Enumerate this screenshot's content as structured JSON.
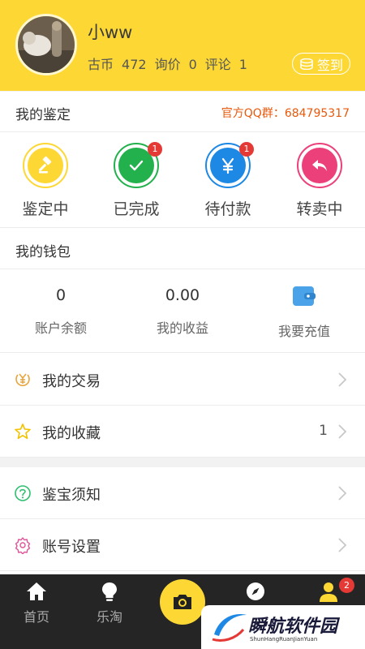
{
  "profile": {
    "username": "小ww",
    "coins_label": "古币",
    "coins_value": "472",
    "inquiry_label": "询价",
    "inquiry_value": "0",
    "comment_label": "评论",
    "comment_value": "1",
    "signin_label": "签到"
  },
  "appraisal": {
    "title": "我的鉴定",
    "qq_group": "官方QQ群：684795317",
    "items": [
      {
        "label": "鉴定中",
        "icon": "gavel-icon",
        "color": "#fdd835",
        "badge": ""
      },
      {
        "label": "已完成",
        "icon": "check-icon",
        "color": "#22b14c",
        "badge": "1"
      },
      {
        "label": "待付款",
        "icon": "yen-icon",
        "color": "#1e88e5",
        "badge": "1"
      },
      {
        "label": "转卖中",
        "icon": "reply-icon",
        "color": "#ec407a",
        "badge": ""
      }
    ]
  },
  "wallet": {
    "title": "我的钱包",
    "balance_value": "0",
    "balance_label": "账户余额",
    "earnings_value": "0.00",
    "earnings_label": "我的收益",
    "recharge_label": "我要充值"
  },
  "menu": [
    {
      "label": "我的交易",
      "icon": "yen-circle-icon",
      "count": ""
    },
    {
      "label": "我的收藏",
      "icon": "star-icon",
      "count": "1"
    },
    {
      "label": "鉴宝须知",
      "icon": "question-icon",
      "count": ""
    },
    {
      "label": "账号设置",
      "icon": "gear-icon",
      "count": ""
    }
  ],
  "tabbar": {
    "home_label": "首页",
    "market_label": "乐淘",
    "profile_badge": "2"
  },
  "watermark": {
    "main": "瞬航软件园",
    "sub": "ShunHangRuanJianYuan"
  }
}
